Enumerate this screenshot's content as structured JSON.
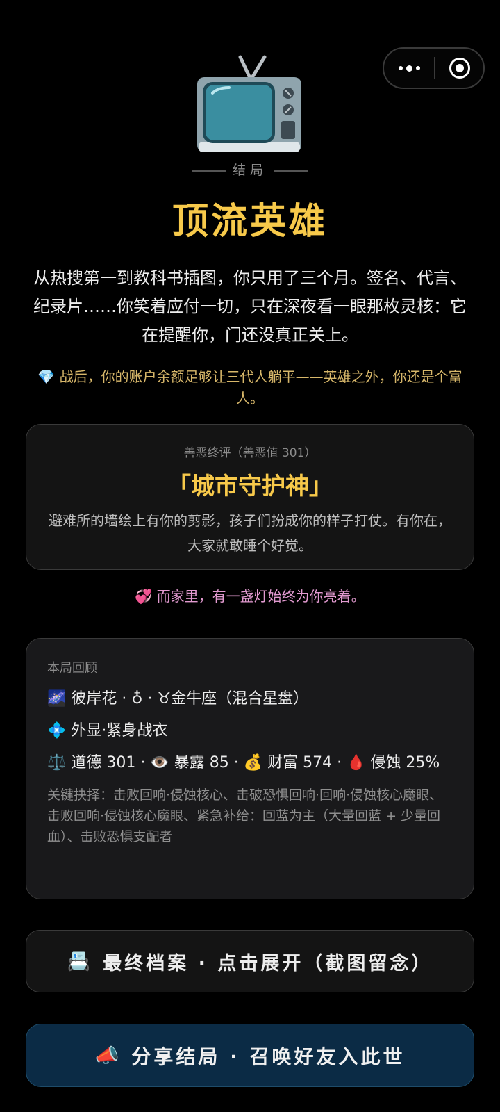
{
  "ending": {
    "label": "结局",
    "title": "顶流英雄",
    "story": "从热搜第一到教科书插图，你只用了三个月。签名、代言、纪录片……你笑着应付一切，只在深夜看一眼那枚灵核：它在提醒你，门还没真正关上。",
    "wealth_icon": "💎",
    "wealth_note": "战后，你的账户余额足够让三代人躺平——英雄之外，你还是个富人。"
  },
  "verdict": {
    "subtitle": "善恶终评（善恶值 301）",
    "name": "「城市守护神」",
    "description": "避难所的墙绘上有你的剪影，孩子们扮成你的样子打仗。有你在，大家就敢睡个好觉。"
  },
  "family": {
    "icon": "💞",
    "text": "而家里，有一盏灯始终为你亮着。"
  },
  "review": {
    "header": "本局回顾",
    "identity": "🌌 彼岸花 · ♁ · ♉金牛座（混合星盘）",
    "appearance": "💠 外显·紧身战衣",
    "stats": "⚖️ 道德 301 · 👁️ 暴露 85 · 💰 财富 574 · 🩸 侵蚀 25%",
    "choices": "关键抉择：击败回响·侵蚀核心、击破恐惧回响·回响·侵蚀核心魔眼、击败回响·侵蚀核心魔眼、紧急补给：回蓝为主（大量回蓝 + 少量回血）、击败恐惧支配者"
  },
  "buttons": {
    "archive_icon": "📇",
    "archive": "最终档案 · 点击展开（截图留念）",
    "share_icon": "📣",
    "share": "分享结局 · 召唤好友入此世"
  },
  "icons": {
    "tv": "television-icon",
    "more": "more-dots-icon",
    "close": "target-close-icon"
  },
  "colors": {
    "accent_gold": "#f7c94a",
    "wealth": "#d7b76a",
    "family": "#e29ad0",
    "share_bg": "#0b2b45"
  }
}
